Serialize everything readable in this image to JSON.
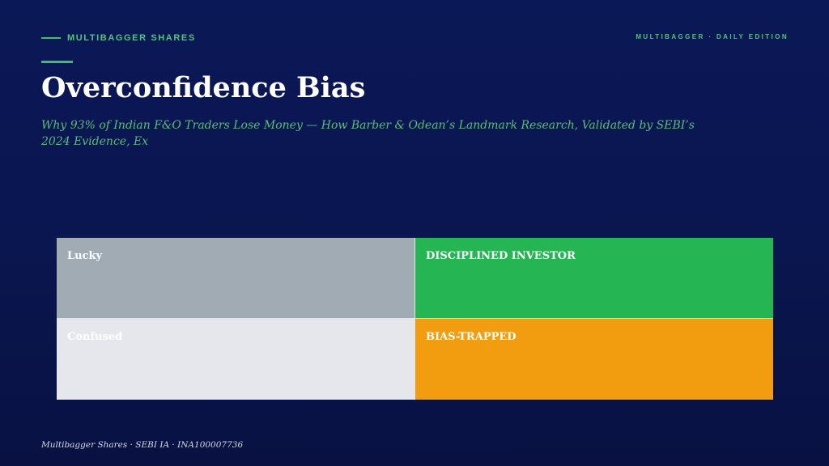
{
  "header": {
    "brand": "MULTIBAGGER SHARES",
    "edition": "MULTIBAGGER · DAILY EDITION"
  },
  "slide": {
    "title": "Overconfidence Bias",
    "subtitle": "Why 93% of Indian F&O Traders Lose Money — How Barber & Odean’s Landmark Research, Validated by SEBI’s 2024 Evidence, Ex"
  },
  "matrix": {
    "quadrants": [
      {
        "label": "Lucky",
        "color": "#a0abb4"
      },
      {
        "label": "DISCIPLINED INVESTOR",
        "color": "#25b653"
      },
      {
        "label": "Confused",
        "color": "#e5e7ec"
      },
      {
        "label": "BIAS-TRAPPED",
        "color": "#f29d10"
      }
    ]
  },
  "footer": {
    "text": "Multibagger Shares · SEBI IA · INA100007736"
  },
  "colors": {
    "background": "#0a1650",
    "accent": "#3fbf63"
  }
}
